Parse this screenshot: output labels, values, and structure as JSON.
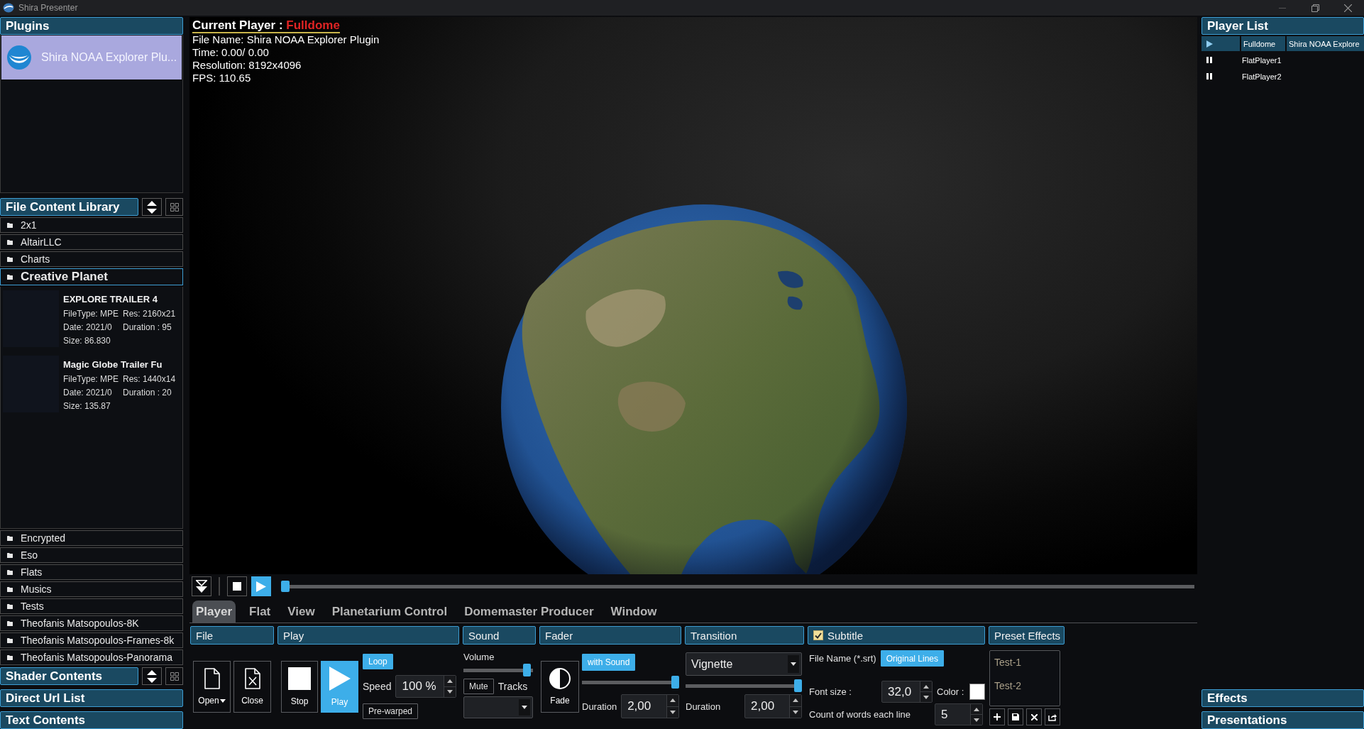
{
  "window": {
    "title": "Shira Presenter"
  },
  "plugins": {
    "title": "Plugins",
    "items": [
      {
        "label": "Shira NOAA Explorer Plu...",
        "selected": true
      }
    ]
  },
  "library": {
    "title": "File Content Library",
    "folders": [
      {
        "name": "2x1",
        "expanded": false
      },
      {
        "name": "AltairLLC",
        "expanded": false
      },
      {
        "name": "Charts",
        "expanded": false
      },
      {
        "name": "Creative Planet",
        "expanded": true,
        "children": [
          {
            "title": "EXPLORE TRAILER 4",
            "file_type": "FileType: MPE",
            "res": "Res: 2160x21",
            "date": "Date: 2021/0",
            "duration": "Duration : 95",
            "size": "Size: 86.830"
          },
          {
            "title": "Magic Globe Trailer Fu",
            "file_type": "FileType: MPE",
            "res": "Res: 1440x14",
            "date": "Date: 2021/0",
            "duration": "Duration : 20",
            "size": "Size: 135.87"
          }
        ]
      },
      {
        "name": "Encrypted",
        "expanded": false
      },
      {
        "name": "Eso",
        "expanded": false
      },
      {
        "name": "Flats",
        "expanded": false
      },
      {
        "name": "Musics",
        "expanded": false
      },
      {
        "name": "Tests",
        "expanded": false
      },
      {
        "name": "Theofanis Matsopoulos-8K",
        "expanded": false
      },
      {
        "name": "Theofanis Matsopoulos-Frames-8k",
        "expanded": false
      },
      {
        "name": "Theofanis Matsopoulos-Panorama",
        "expanded": false
      }
    ]
  },
  "shader_contents": {
    "title": "Shader Contents"
  },
  "direct_url_list": {
    "title": "Direct Url List"
  },
  "text_contents": {
    "title": "Text Contents"
  },
  "viewer": {
    "current_player_label": "Current Player :",
    "current_player": "Fulldome",
    "lines": [
      "File Name: Shira NOAA Explorer Plugin",
      "Time: 0.00/ 0.00",
      "Resolution: 8192x4096",
      "FPS: 110.65"
    ]
  },
  "transport": {
    "buttons": [
      {
        "kind": "collapse",
        "active": false
      },
      {
        "kind": "stop",
        "active": false
      },
      {
        "kind": "play",
        "active": true
      }
    ],
    "position": {
      "level": 0
    }
  },
  "tabs": [
    {
      "label": "Player",
      "selected": true
    },
    {
      "label": "Flat",
      "selected": false
    },
    {
      "label": "View",
      "selected": false
    },
    {
      "label": "Planetarium Control",
      "selected": false
    },
    {
      "label": "Domemaster Producer",
      "selected": false
    },
    {
      "label": "Window",
      "selected": false
    }
  ],
  "file_group": {
    "title": "File",
    "buttons": [
      {
        "kind": "open",
        "label": "Open"
      },
      {
        "kind": "close",
        "label": "Close"
      }
    ]
  },
  "play_group": {
    "title": "Play",
    "buttons": [
      {
        "kind": "stop",
        "label": "Stop",
        "active": false
      },
      {
        "kind": "play",
        "label": "Play",
        "active": true
      }
    ],
    "loop": {
      "label": "Loop",
      "on": true
    },
    "speed": {
      "label": "Speed",
      "value": "100 %"
    },
    "prewarped": {
      "label": "Pre-warped",
      "on": false
    }
  },
  "sound_group": {
    "title": "Sound",
    "volume": {
      "label": "Volume",
      "level": 0.96
    },
    "mute": {
      "label": "Mute",
      "on": false
    },
    "tracks": {
      "label": "Tracks"
    }
  },
  "fader_group": {
    "title": "Fader",
    "fade": {
      "label": "Fade"
    },
    "with_sound": {
      "label": "with Sound",
      "on": true
    },
    "slider": {
      "level": 1
    },
    "duration": {
      "label": "Duration",
      "value": "2,00"
    }
  },
  "transition_group": {
    "title": "Transition",
    "effect": {
      "value": "Vignette"
    },
    "slider": {
      "level": 1
    },
    "duration": {
      "label": "Duration",
      "value": "2,00"
    }
  },
  "subtitle_group": {
    "title": "Subtitle",
    "checked": true,
    "file_name_label": "File Name (*.srt)",
    "original_lines": {
      "label": "Original Lines",
      "on": true
    },
    "font_size": {
      "label": "Font size :",
      "value": "32,0"
    },
    "color": {
      "label": "Color :",
      "color": "#ffffff"
    },
    "words_per_line": {
      "label": "Count of words each line",
      "value": "5"
    }
  },
  "preset_effects_group": {
    "title": "Preset Effects",
    "items": [
      {
        "label": "Test-1",
        "selected": false
      },
      {
        "label": "Test-2",
        "selected": false
      }
    ],
    "actions": [
      {
        "kind": "add"
      },
      {
        "kind": "save"
      },
      {
        "kind": "delete"
      },
      {
        "kind": "export"
      }
    ]
  },
  "player_list": {
    "title": "Player List",
    "players": [
      {
        "playing": true,
        "name": "Fulldome",
        "plugin": "Shira NOAA Explore",
        "selected": true
      },
      {
        "playing": false,
        "name": "FlatPlayer1",
        "selected": false
      },
      {
        "playing": false,
        "name": "FlatPlayer2",
        "selected": false
      }
    ]
  },
  "effects": {
    "title": "Effects"
  },
  "presentations": {
    "title": "Presentations"
  }
}
